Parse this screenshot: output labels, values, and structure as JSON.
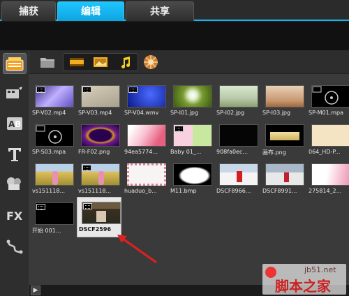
{
  "tabs": [
    {
      "label": "捕获",
      "active": false
    },
    {
      "label": "编辑",
      "active": true
    },
    {
      "label": "共享",
      "active": false
    }
  ],
  "left_toolbar": [
    "media-library-icon",
    "instant-project-icon",
    "transition-icon",
    "title-icon",
    "graphics-icon",
    "fx-icon",
    "motion-path-icon"
  ],
  "library_toolbar": [
    "folder-icon",
    "video-icon",
    "photo-icon",
    "audio-icon",
    "online-icon"
  ],
  "media_items": [
    {
      "caption": "SP-V02.mp4",
      "thumb": "video-purple"
    },
    {
      "caption": "SP-V03.mp4",
      "thumb": "video-beige"
    },
    {
      "caption": "SP-V04.wmv",
      "thumb": "video-blue"
    },
    {
      "caption": "SP-I01.jpg",
      "thumb": "dandelion"
    },
    {
      "caption": "SP-I02.jpg",
      "thumb": "beach"
    },
    {
      "caption": "SP-I03.jpg",
      "thumb": "tree"
    },
    {
      "caption": "SP-M01.mpa",
      "thumb": "audio-black"
    },
    {
      "caption": "SP-S03.mpa",
      "thumb": "audio-disc"
    },
    {
      "caption": "FR-F02.png",
      "thumb": "frame-gold"
    },
    {
      "caption": "94ea5774...",
      "thumb": "pink-blossom"
    },
    {
      "caption": "Baby 01_...",
      "thumb": "baby-frame"
    },
    {
      "caption": "908fa0ec...",
      "thumb": "black-frame"
    },
    {
      "caption": "画布.png",
      "thumb": "canvas"
    },
    {
      "caption": "064_HD-P...",
      "thumb": "cream"
    },
    {
      "caption": "vs151118...",
      "thumb": "girl-field"
    },
    {
      "caption": "vs151118...",
      "thumb": "girl-field-2"
    },
    {
      "caption": "huaduo_b...",
      "thumb": "flower-border"
    },
    {
      "caption": "M11.bmp",
      "thumb": "mask"
    },
    {
      "caption": "DSCF8966...",
      "thumb": "snow-red"
    },
    {
      "caption": "DSCF8991...",
      "thumb": "snow-bridge"
    },
    {
      "caption": "275814_2...",
      "thumb": "pink-light"
    },
    {
      "caption": "开始 001...",
      "thumb": "start-black"
    },
    {
      "caption": "DSCF2596",
      "thumb": "selected-photo"
    }
  ],
  "watermark": {
    "site": "jb51.net",
    "name": "脚本之家"
  },
  "colors": {
    "accent": "#12b7f0",
    "arrow": "#e02020"
  }
}
